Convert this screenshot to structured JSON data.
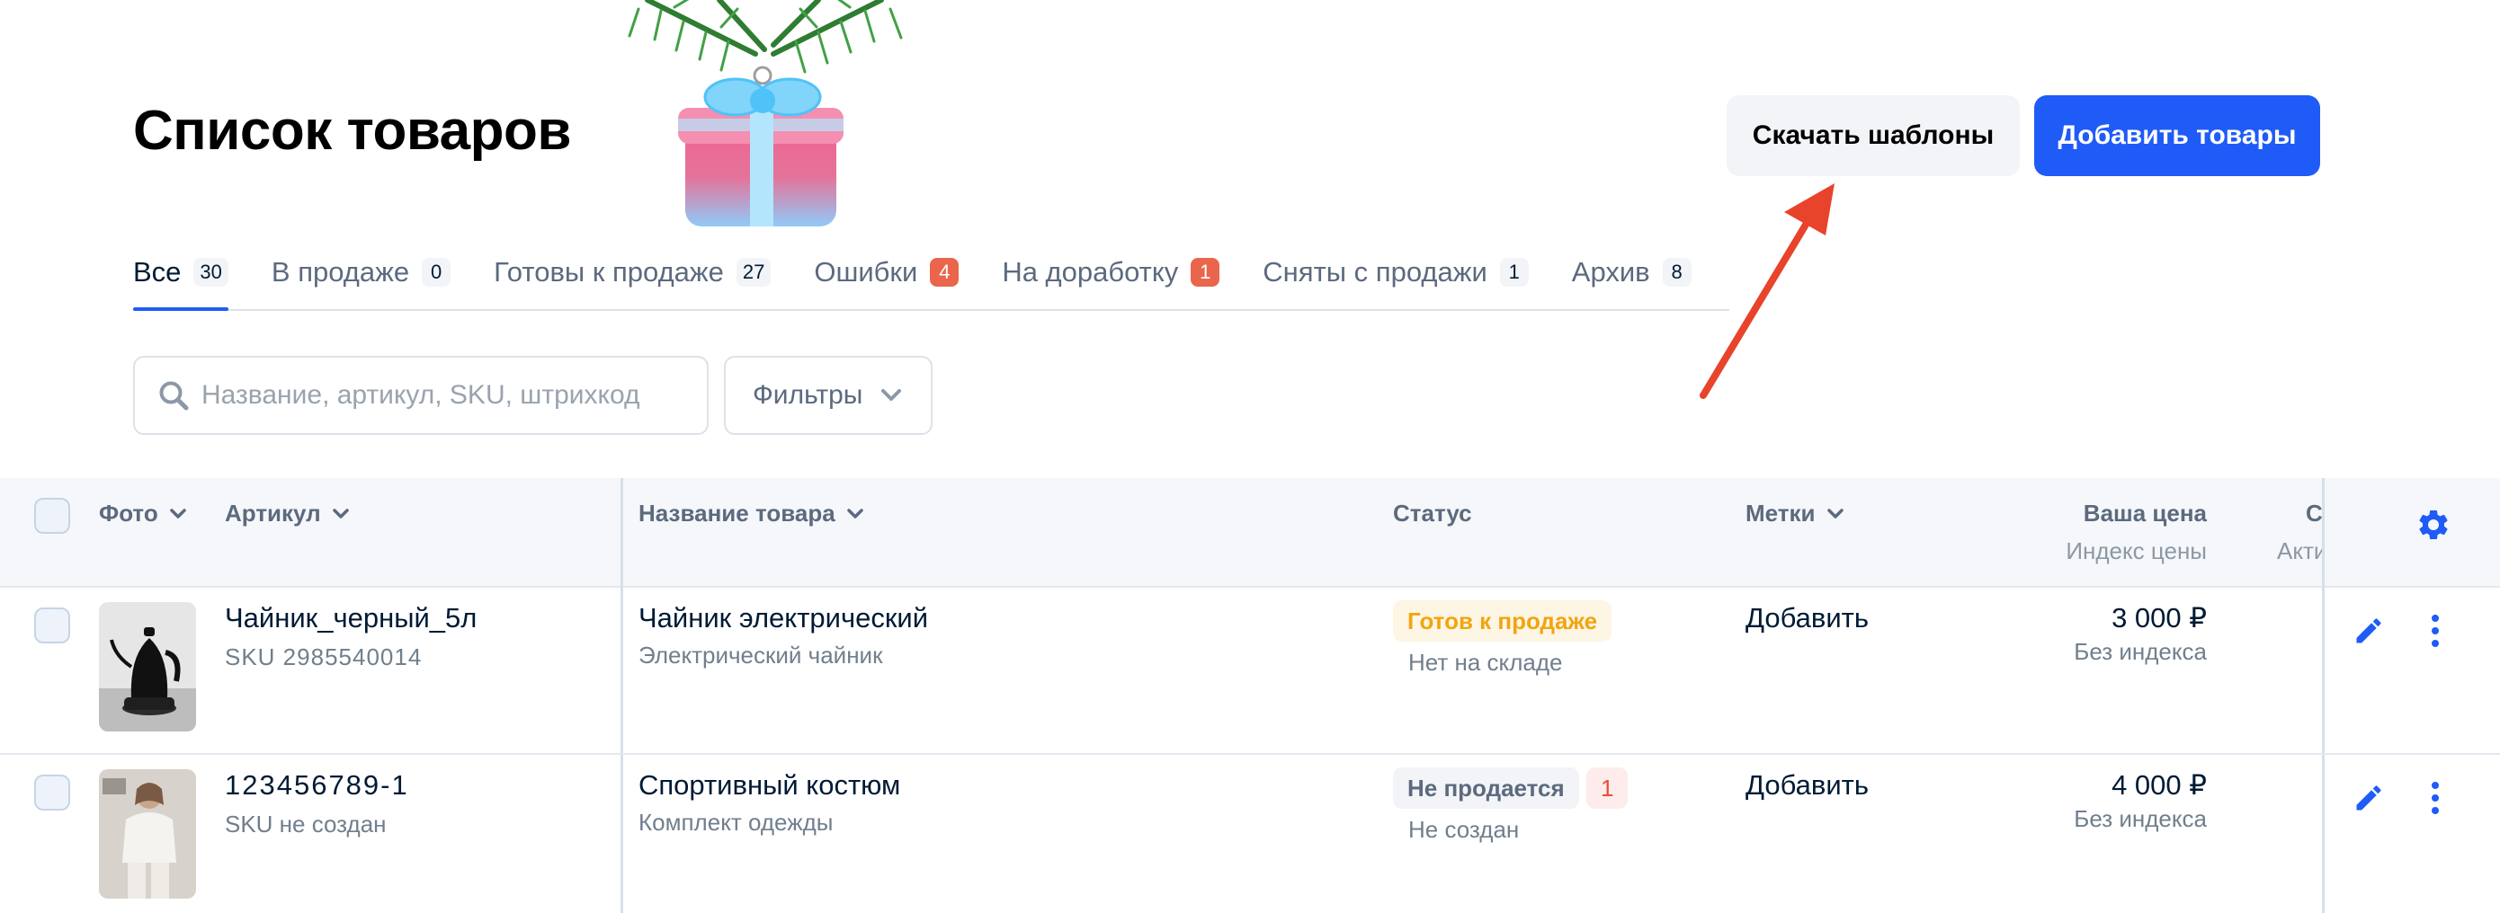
{
  "page": {
    "title": "Список товаров"
  },
  "header": {
    "download_templates_label": "Скачать шаблоны",
    "add_products_label": "Добавить товары"
  },
  "tabs": [
    {
      "label": "Все",
      "count": "30"
    },
    {
      "label": "В продаже",
      "count": "0"
    },
    {
      "label": "Готовы к продаже",
      "count": "27"
    },
    {
      "label": "Ошибки",
      "count": "4"
    },
    {
      "label": "На доработку",
      "count": "1"
    },
    {
      "label": "Сняты с продажи",
      "count": "1"
    },
    {
      "label": "Архив",
      "count": "8"
    }
  ],
  "search": {
    "placeholder": "Название, артикул, SKU, штрихкод"
  },
  "filters": {
    "label": "Фильтры"
  },
  "table": {
    "columns": {
      "photo": "Фото",
      "article": "Артикул",
      "name": "Название товара",
      "status": "Статус",
      "tags": "Метки",
      "price": "Ваша цена",
      "price_sub": "Индекс цены",
      "cut_col": "С",
      "cut_col_sub": "Акти"
    },
    "rows": [
      {
        "article": "Чайник_черный_5л",
        "sku": "SKU 2985540014",
        "name": "Чайник электрический",
        "category": "Электрический чайник",
        "status": "Готов к продаже",
        "status_sub": "Нет на складе",
        "tags": "Добавить",
        "price": "3 000 ₽",
        "price_sub": "Без индекса"
      },
      {
        "article": "123456789-1",
        "sku": "SKU не создан",
        "name": "Спортивный костюм",
        "category": "Комплект одежды",
        "status": "Не продается",
        "status_count": "1",
        "status_sub": "Не создан",
        "tags": "Добавить",
        "price": "4 000 ₽",
        "price_sub": "Без индекса"
      }
    ]
  },
  "colors": {
    "primary": "#1f5bf7",
    "arrow": "#e8432b",
    "badge_red": "#e9664c",
    "status_ready": "#f1a511"
  },
  "icons": [
    "search-icon",
    "chevron-down-icon",
    "gear-icon",
    "pencil-icon",
    "more-vertical-icon",
    "arrow-annotation-icon",
    "gift-ornament-icon"
  ]
}
